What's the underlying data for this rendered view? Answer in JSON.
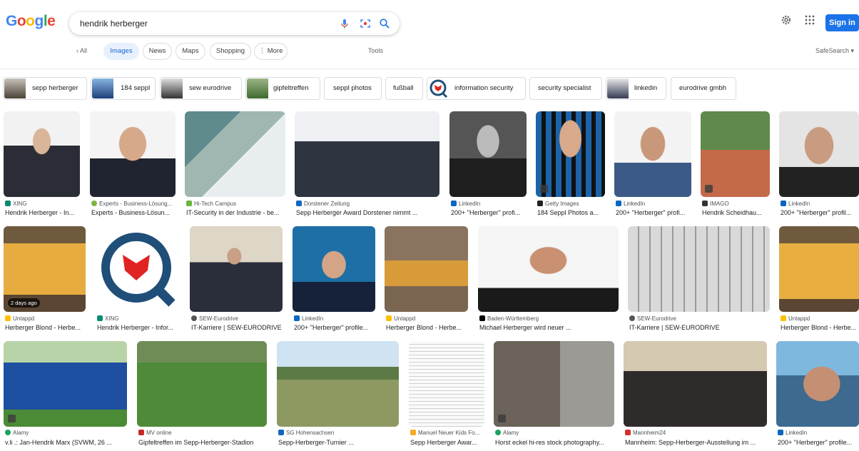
{
  "search": {
    "query": "hendrik herberger"
  },
  "header": {
    "signin_label": "Sign in"
  },
  "tabs": {
    "back": "‹  All",
    "items": [
      "Images",
      "News",
      "Maps",
      "Shopping",
      "⋮ More"
    ],
    "tools": "Tools",
    "safesearch": "SafeSearch ▾"
  },
  "related": [
    "sepp herberger",
    "184 seppl",
    "sew eurodrive",
    "gipfeltreffen",
    "seppl photos",
    "fußball",
    "information security",
    "security specialist",
    "linkedin",
    "eurodrive gmbh"
  ],
  "results": [
    {
      "src": "XING",
      "title": "Hendrik Herberger - In..."
    },
    {
      "src": "Experts - Business-Lösung...",
      "title": "Experts - Business-Lösun..."
    },
    {
      "src": "Hi-Tech Campus",
      "title": "IT-Security in der Industrie - be..."
    },
    {
      "src": "Dorstener Zeitung",
      "title": "Sepp Herberger Award Dorstener nimmt ..."
    },
    {
      "src": "LinkedIn",
      "title": "200+ \"Herberger\" profi..."
    },
    {
      "src": "Getty Images",
      "title": "184 Seppl Photos a..."
    },
    {
      "src": "LinkedIn",
      "title": "200+ \"Herberger\" profi..."
    },
    {
      "src": "IMAGO",
      "title": "Hendrik Scheidhau..."
    },
    {
      "src": "LinkedIn",
      "title": "200+ \"Herberger\" profil..."
    },
    {
      "src": "Untappd",
      "title": "Herberger Blond - Herbe...",
      "badge": "2 days ago"
    },
    {
      "src": "XING",
      "title": "Hendrik Herberger - Infor..."
    },
    {
      "src": "SEW-Eurodrive",
      "title": "IT-Karriere | SEW-EURODRIVE"
    },
    {
      "src": "LinkedIn",
      "title": "200+ \"Herberger\" profile..."
    },
    {
      "src": "Untappd",
      "title": "Herberger Blond - Herbe..."
    },
    {
      "src": "Baden-Württemberg",
      "title": "Michael Herberger wird neuer ..."
    },
    {
      "src": "SEW-Eurodrive",
      "title": "IT-Karriere | SEW-EURODRIVE"
    },
    {
      "src": "Untappd",
      "title": "Herberger Blond - Herbe..."
    },
    {
      "src": "Alamy",
      "title": "v.li .: Jan-Hendrik Marx (SVWM, 26 ..."
    },
    {
      "src": "MV online",
      "title": "Gipfeltreffen im Sepp-Herberger-Stadion"
    },
    {
      "src": "SG Hohensachsen",
      "title": "Sepp-Herberger-Turnier ..."
    },
    {
      "src": "Manuel Neuer Kids Fo...",
      "title": "Sepp Herberger Awar..."
    },
    {
      "src": "Alamy",
      "title": "Horst eckel hi-res stock photography..."
    },
    {
      "src": "Mannheim24",
      "title": "Mannheim: Sepp-Herberger-Ausstellung im ..."
    },
    {
      "src": "LinkedIn",
      "title": "200+ \"Herberger\" profile..."
    }
  ]
}
